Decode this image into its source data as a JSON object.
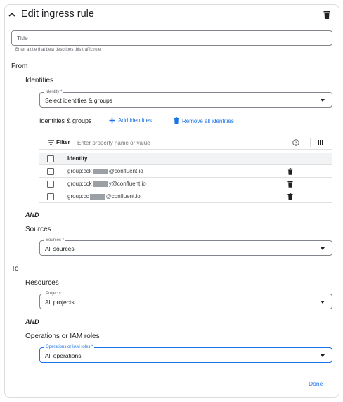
{
  "header": {
    "title": "Edit ingress rule",
    "collapse_icon": "chevron-up-icon",
    "delete_icon": "trash-icon"
  },
  "title_field": {
    "placeholder": "Title",
    "value": "",
    "hint": "Enter a title that best describes this traffic rule"
  },
  "from": {
    "label": "From",
    "identities": {
      "label": "Identities",
      "select": {
        "legend": "Identity *",
        "value": "Select identities & groups"
      },
      "groups_label": "Identities & groups",
      "add_label": "Add identities",
      "remove_label": "Remove all identities",
      "filter": {
        "label": "Filter",
        "placeholder": "Enter property name or value"
      },
      "table": {
        "header": "Identity",
        "rows": [
          {
            "prefix": "group:cck",
            "suffix": "@confluent.io"
          },
          {
            "prefix": "group:cck",
            "suffix": "y@confluent.io"
          },
          {
            "prefix": "group:cc",
            "suffix": "@confluent.io"
          }
        ]
      }
    },
    "and_label": "AND",
    "sources": {
      "label": "Sources",
      "legend": "Sources *",
      "value": "All sources"
    }
  },
  "to": {
    "label": "To",
    "resources": {
      "label": "Resources",
      "legend": "Projects *",
      "value": "All projects"
    },
    "and_label": "AND",
    "operations": {
      "label": "Operations or IAM roles",
      "legend": "Operations or IAM roles *",
      "value": "All operations"
    }
  },
  "footer": {
    "done_label": "Done"
  },
  "colors": {
    "accent": "#1a73e8",
    "text": "#202124",
    "muted": "#5f6368",
    "border": "#dadce0"
  }
}
